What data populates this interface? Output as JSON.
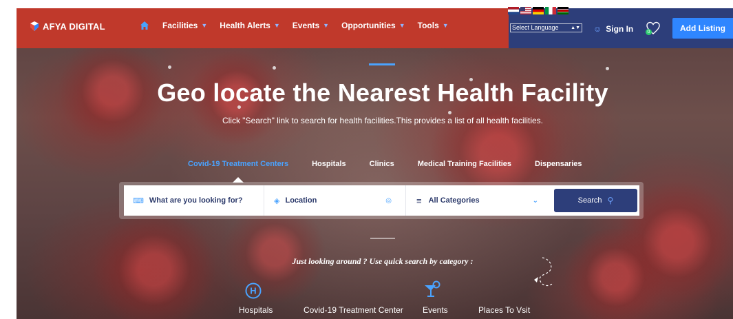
{
  "brand": {
    "logo_text": "AFYA DIGITAL"
  },
  "nav": {
    "items": [
      {
        "label": "Facilities"
      },
      {
        "label": "Health Alerts"
      },
      {
        "label": "Events"
      },
      {
        "label": "Opportunities"
      },
      {
        "label": "Tools"
      }
    ]
  },
  "header": {
    "language_select": "Select Language",
    "sign_in": "Sign In",
    "favorites_count": "0",
    "add_listing": "Add Listing"
  },
  "hero": {
    "title": "Geo locate the Nearest Health Facility",
    "subtitle": "Click \"Search\" link to search for health facilities.This provides a list of all health facilities.",
    "tabs": [
      {
        "label": "Covid-19 Treatment Centers",
        "active": true
      },
      {
        "label": "Hospitals",
        "active": false
      },
      {
        "label": "Clinics",
        "active": false
      },
      {
        "label": "Medical Training Facilities",
        "active": false
      },
      {
        "label": "Dispensaries",
        "active": false
      }
    ]
  },
  "search": {
    "what_placeholder": "What are you looking for?",
    "location_placeholder": "Location",
    "category_value": "All Categories",
    "button_label": "Search"
  },
  "quick_search": {
    "prompt": "Just looking around ? Use quick search by category :",
    "categories": [
      {
        "label": "Hospitals",
        "icon": "hospital-icon"
      },
      {
        "label": "Covid-19 Treatment Center",
        "icon": ""
      },
      {
        "label": "Events",
        "icon": "cocktail-icon"
      },
      {
        "label": "Places To Vsit",
        "icon": ""
      }
    ]
  },
  "colors": {
    "header_red": "#c0392b",
    "header_navy": "#2d3e7a",
    "accent_blue": "#4aa3ff",
    "button_blue": "#2f86ff"
  }
}
